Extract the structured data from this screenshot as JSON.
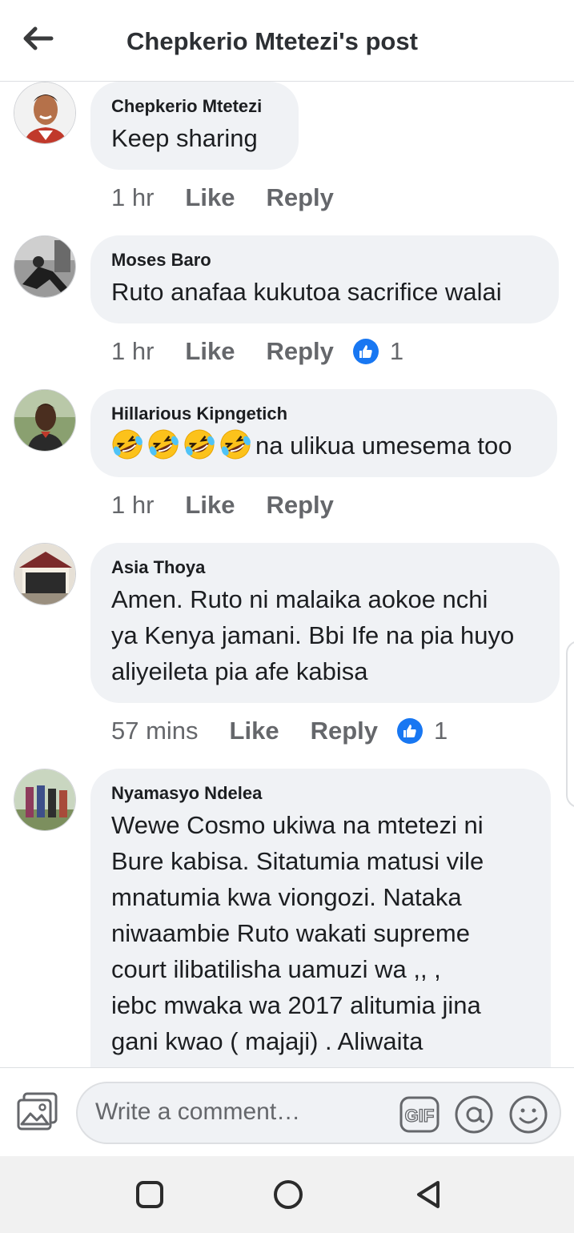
{
  "header": {
    "title": "Chepkerio Mtetezi's post"
  },
  "comments": [
    {
      "author": "Chepkerio Mtetezi",
      "lines": [
        "Keep sharing"
      ],
      "time": "1 hr",
      "like": "Like",
      "reply": "Reply",
      "reactions": null
    },
    {
      "author": "Moses Baro",
      "lines": [
        "Ruto anafaa kukutoa sacrifice walai"
      ],
      "time": "1 hr",
      "like": "Like",
      "reply": "Reply",
      "reactions": "1"
    },
    {
      "author": "Hillarious Kipngetich",
      "emoji": [
        "rolling-on-floor-laughing",
        "rolling-on-floor-laughing",
        "rolling-on-floor-laughing",
        "rolling-on-floor-laughing"
      ],
      "lines": [
        "na ulikua umesema too"
      ],
      "time": "1 hr",
      "like": "Like",
      "reply": "Reply",
      "reactions": null
    },
    {
      "author": "Asia Thoya",
      "lines": [
        "Amen. Ruto ni malaika aokoe nchi",
        "ya Kenya jamani. Bbi Ife na pia huyo",
        "aliyeileta pia afe kabisa"
      ],
      "time": "57 mins",
      "like": "Like",
      "reply": "Reply",
      "reactions": "1"
    },
    {
      "author": "Nyamasyo Ndelea",
      "lines": [
        "Wewe Cosmo ukiwa na mtetezi ni",
        "Bure kabisa. Sitatumia matusi vile",
        "mnatumia kwa viongozi. Nataka",
        "niwaambie Ruto wakati supreme",
        "court  ilibatilisha  uamuzi  wa ,, ,",
        "iebc  mwaka wa 2017  alitumia jina",
        "gani kwao ( majaji)   . Aliwaita"
      ]
    }
  ],
  "composer": {
    "placeholder": "Write a comment…",
    "gif_label": "GIF"
  },
  "colors": {
    "accent": "#1877f2",
    "bubble": "#f0f2f5",
    "muted": "#65676b"
  }
}
